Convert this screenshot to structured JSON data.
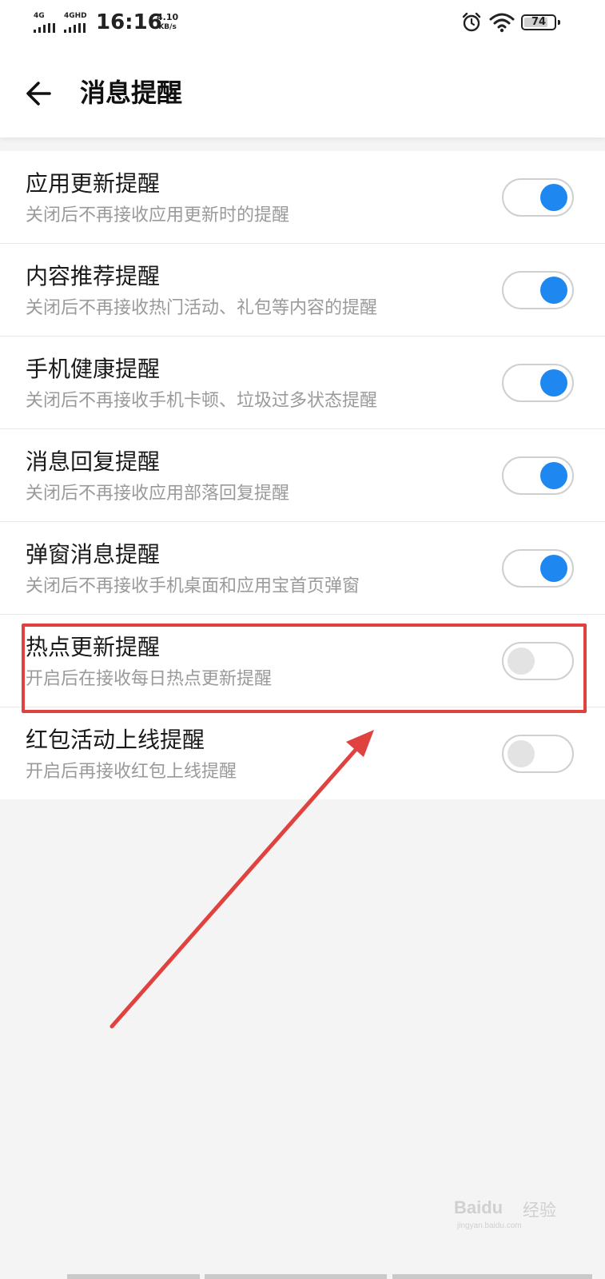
{
  "status_bar": {
    "signal1_label": "4G",
    "signal2_label": "4GHD",
    "time": "16:16",
    "speed_value": "4.10",
    "speed_unit": "KB/s",
    "battery": "74",
    "icons": [
      "alarm-icon",
      "wifi-icon",
      "battery-icon"
    ]
  },
  "header": {
    "title": "消息提醒",
    "back_icon": "back-arrow-icon"
  },
  "settings": [
    {
      "title": "应用更新提醒",
      "description": "关闭后不再接收应用更新时的提醒",
      "enabled": true
    },
    {
      "title": "内容推荐提醒",
      "description": "关闭后不再接收热门活动、礼包等内容的提醒",
      "enabled": true
    },
    {
      "title": "手机健康提醒",
      "description": "关闭后不再接收手机卡顿、垃圾过多状态提醒",
      "enabled": true
    },
    {
      "title": "消息回复提醒",
      "description": "关闭后不再接收应用部落回复提醒",
      "enabled": true
    },
    {
      "title": "弹窗消息提醒",
      "description": "关闭后不再接收手机桌面和应用宝首页弹窗",
      "enabled": true
    },
    {
      "title": "热点更新提醒",
      "description": "开启后在接收每日热点更新提醒",
      "enabled": false
    },
    {
      "title": "红包活动上线提醒",
      "description": "开启后再接收红包上线提醒",
      "enabled": false
    }
  ],
  "annotation": {
    "highlight_color": "#e0433f"
  },
  "colors": {
    "toggle_on": "#1e87f0",
    "toggle_off": "#e3e3e3",
    "background": "#f4f4f4"
  },
  "watermark": {
    "brand": "Baidu",
    "name": "经验",
    "url": "jingyan.baidu.com"
  }
}
